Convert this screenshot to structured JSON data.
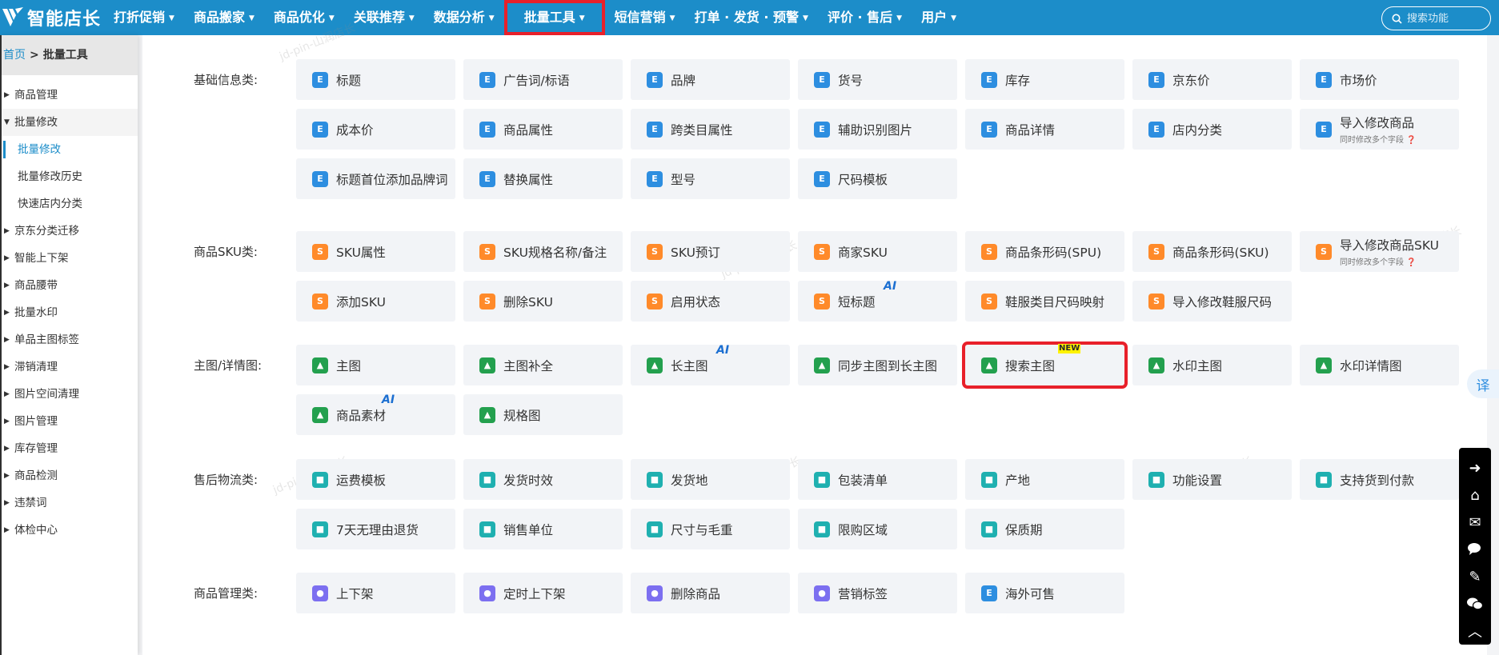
{
  "brand": {
    "name": "智能店长"
  },
  "nav": {
    "items": [
      {
        "label": "打折促销"
      },
      {
        "label": "商品搬家"
      },
      {
        "label": "商品优化"
      },
      {
        "label": "关联推荐"
      },
      {
        "label": "数据分析"
      },
      {
        "label": "批量工具"
      },
      {
        "label": "短信营销"
      },
      {
        "label": "打单 · 发货 · 预警"
      },
      {
        "label": "评价 · 售后"
      },
      {
        "label": "用户"
      }
    ],
    "search_placeholder": "搜索功能"
  },
  "breadcrumb": {
    "home": "首页",
    "sep": ">",
    "current": "批量工具"
  },
  "sidebar": {
    "items": [
      {
        "label": "商品管理"
      },
      {
        "label": "批量修改"
      },
      {
        "label": "批量修改"
      },
      {
        "label": "批量修改历史"
      },
      {
        "label": "快速店内分类"
      },
      {
        "label": "京东分类迁移"
      },
      {
        "label": "智能上下架"
      },
      {
        "label": "商品腰带"
      },
      {
        "label": "批量水印"
      },
      {
        "label": "单品主图标签"
      },
      {
        "label": "滞销清理"
      },
      {
        "label": "图片空间清理"
      },
      {
        "label": "图片管理"
      },
      {
        "label": "库存管理"
      },
      {
        "label": "商品检测"
      },
      {
        "label": "违禁词"
      },
      {
        "label": "体检中心"
      }
    ]
  },
  "sections": [
    {
      "label": "基础信息类:",
      "buttons": [
        {
          "label": "标题",
          "icon": "title-icon",
          "color": "blue"
        },
        {
          "label": "广告词/标语",
          "icon": "ad-icon",
          "color": "blue"
        },
        {
          "label": "品牌",
          "icon": "brand-icon",
          "color": "blue"
        },
        {
          "label": "货号",
          "icon": "barcode-icon",
          "color": "blue"
        },
        {
          "label": "库存",
          "icon": "stock-icon",
          "color": "blue"
        },
        {
          "label": "京东价",
          "icon": "price-icon",
          "color": "blue"
        },
        {
          "label": "市场价",
          "icon": "price-tag-icon",
          "color": "blue"
        },
        {
          "label": "成本价",
          "icon": "calculator-icon",
          "color": "blue"
        },
        {
          "label": "商品属性",
          "icon": "gear-icon",
          "color": "blue"
        },
        {
          "label": "跨类目属性",
          "icon": "document-icon",
          "color": "blue"
        },
        {
          "label": "辅助识别图片",
          "icon": "image-icon",
          "color": "blue"
        },
        {
          "label": "商品详情",
          "icon": "bag-icon",
          "color": "blue"
        },
        {
          "label": "店内分类",
          "icon": "grid-icon",
          "color": "blue"
        },
        {
          "label": "导入修改商品",
          "sub": "同时修改多个字段 ❓",
          "icon": "import-icon",
          "color": "blue"
        },
        {
          "label": "标题首位添加品牌词",
          "icon": "title-icon",
          "color": "blue"
        },
        {
          "label": "替换属性",
          "icon": "gear-icon",
          "color": "blue"
        },
        {
          "label": "型号",
          "icon": "gear-icon",
          "color": "blue"
        },
        {
          "label": "尺码模板",
          "icon": "ruler-icon",
          "color": "blue"
        }
      ]
    },
    {
      "label": "商品SKU类:",
      "buttons": [
        {
          "label": "SKU属性",
          "icon": "sku-icon",
          "color": "orange"
        },
        {
          "label": "SKU规格名称/备注",
          "icon": "sku-spec-icon",
          "color": "orange"
        },
        {
          "label": "SKU预订",
          "icon": "clock-icon",
          "color": "orange"
        },
        {
          "label": "商家SKU",
          "icon": "sku-icon",
          "color": "orange"
        },
        {
          "label": "商品条形码(SPU)",
          "icon": "upc-icon",
          "color": "orange"
        },
        {
          "label": "商品条形码(SKU)",
          "icon": "upc-icon",
          "color": "orange"
        },
        {
          "label": "导入修改商品SKU",
          "sub": "同时修改多个字段 ❓",
          "icon": "import-icon",
          "color": "orange"
        },
        {
          "label": "添加SKU",
          "icon": "sku-icon",
          "color": "orange"
        },
        {
          "label": "删除SKU",
          "icon": "sku-icon",
          "color": "orange"
        },
        {
          "label": "启用状态",
          "icon": "sku-icon",
          "color": "orange"
        },
        {
          "label": "短标题",
          "icon": "short-title-icon",
          "color": "orange",
          "tag": "AI"
        },
        {
          "label": "鞋服类目尺码映射",
          "icon": "size-map-icon",
          "color": "orange"
        },
        {
          "label": "导入修改鞋服尺码",
          "icon": "size-map-icon",
          "color": "orange"
        }
      ]
    },
    {
      "label": "主图/详情图:",
      "buttons": [
        {
          "label": "主图",
          "icon": "picture-icon",
          "color": "green"
        },
        {
          "label": "主图补全",
          "icon": "picture-fill-icon",
          "color": "green"
        },
        {
          "label": "长主图",
          "icon": "long-picture-icon",
          "color": "green",
          "tag": "AI"
        },
        {
          "label": "同步主图到长主图",
          "icon": "sync-icon",
          "color": "green"
        },
        {
          "label": "搜索主图",
          "icon": "search-picture-icon",
          "color": "green",
          "tag": "NEW"
        },
        {
          "label": "水印主图",
          "icon": "watermark-icon",
          "color": "green"
        },
        {
          "label": "水印详情图",
          "icon": "watermark-icon",
          "color": "green"
        },
        {
          "label": "商品素材",
          "icon": "material-icon",
          "color": "green",
          "tag": "AI"
        },
        {
          "label": "规格图",
          "icon": "spec-picture-icon",
          "color": "green"
        }
      ]
    },
    {
      "label": "售后物流类:",
      "buttons": [
        {
          "label": "运费模板",
          "icon": "truck-icon",
          "color": "teal"
        },
        {
          "label": "发货时效",
          "icon": "timer-icon",
          "color": "teal"
        },
        {
          "label": "发货地",
          "icon": "location-icon",
          "color": "teal"
        },
        {
          "label": "包装清单",
          "icon": "package-icon",
          "color": "teal"
        },
        {
          "label": "产地",
          "icon": "globe-icon",
          "color": "teal"
        },
        {
          "label": "功能设置",
          "icon": "settings-icon",
          "color": "teal"
        },
        {
          "label": "支持货到付款",
          "icon": "cod-icon",
          "color": "teal"
        },
        {
          "label": "7天无理由退货",
          "icon": "calendar-icon",
          "color": "teal"
        },
        {
          "label": "销售单位",
          "icon": "unit-icon",
          "color": "teal"
        },
        {
          "label": "尺寸与毛重",
          "icon": "scale-icon",
          "color": "teal"
        },
        {
          "label": "限购区域",
          "icon": "cart-icon",
          "color": "teal"
        },
        {
          "label": "保质期",
          "icon": "calendar-icon",
          "color": "teal"
        }
      ]
    },
    {
      "label": "商品管理类:",
      "buttons": [
        {
          "label": "上下架",
          "icon": "updown-icon",
          "color": "purple"
        },
        {
          "label": "定时上下架",
          "icon": "alarm-icon",
          "color": "purple"
        },
        {
          "label": "删除商品",
          "icon": "delete-icon",
          "color": "purple"
        },
        {
          "label": "营销标签",
          "icon": "tag-icon",
          "color": "purple"
        },
        {
          "label": "海外可售",
          "icon": "overseas-icon",
          "color": "blue"
        }
      ]
    }
  ],
  "float": {
    "translate_label": "译"
  },
  "watermark_text": "jd-pin-山润店长",
  "colors": {
    "topbar": "#1c8dc9",
    "highlight": "#e8202a",
    "ai_tag": "#1c6fd1",
    "new_tag_bg": "#fff200"
  }
}
